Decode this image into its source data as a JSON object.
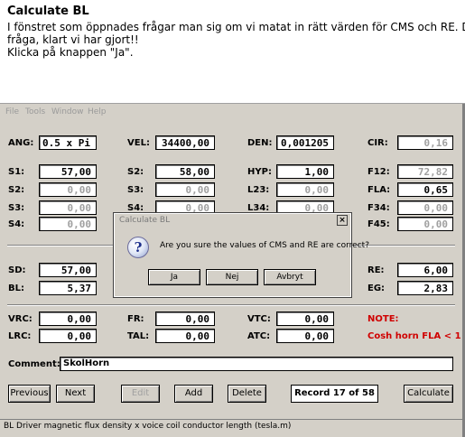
{
  "instructions": {
    "title": "Calculate BL",
    "lines": [
      "I fönstret som öppnades frågar man sig om vi matat in rätt värden för CMS och RE. Dum",
      "fråga, klart vi har gjort!!",
      "Klicka på knappen \"Ja\"."
    ]
  },
  "menu": [
    "File",
    "Tools",
    "Window",
    "Help"
  ],
  "fields": {
    "ang": {
      "label": "ANG:",
      "value": "0.5 x Pi"
    },
    "vel": {
      "label": "VEL:",
      "value": "34400,00"
    },
    "den": {
      "label": "DEN:",
      "value": "0,001205"
    },
    "cir": {
      "label": "CIR:",
      "value": "0,16"
    },
    "s1": {
      "label": "S1:",
      "value": "57,00"
    },
    "s2": {
      "label": "S2:",
      "value": "0,00"
    },
    "s3": {
      "label": "S3:",
      "value": "0,00"
    },
    "s4": {
      "label": "S4:",
      "value": "0,00"
    },
    "s2b": {
      "label": "S2:",
      "value": "58,00"
    },
    "s3b": {
      "label": "S3:",
      "value": "0,00"
    },
    "s4b": {
      "label": "S4:",
      "value": "0,00"
    },
    "hyp": {
      "label": "HYP:",
      "value": "1,00"
    },
    "l23": {
      "label": "L23:",
      "value": "0,00"
    },
    "l34": {
      "label": "L34:",
      "value": "0,00"
    },
    "f12": {
      "label": "F12:",
      "value": "72,82"
    },
    "fla": {
      "label": "FLA:",
      "value": "0,65"
    },
    "f34": {
      "label": "F34:",
      "value": "0,00"
    },
    "f45": {
      "label": "F45:",
      "value": "0,00"
    },
    "sd": {
      "label": "SD:",
      "value": "57,00"
    },
    "bl": {
      "label": "BL:",
      "value": "5,37"
    },
    "re": {
      "label": "RE:",
      "value": "6,00"
    },
    "eg": {
      "label": "EG:",
      "value": "2,83"
    },
    "vrc": {
      "label": "VRC:",
      "value": "0,00"
    },
    "lrc": {
      "label": "LRC:",
      "value": "0,00"
    },
    "fr": {
      "label": "FR:",
      "value": "0,00"
    },
    "tal": {
      "label": "TAL:",
      "value": "0,00"
    },
    "vtc": {
      "label": "VTC:",
      "value": "0,00"
    },
    "atc": {
      "label": "ATC:",
      "value": "0,00"
    }
  },
  "note": {
    "label": "NOTE:",
    "text": "Cosh horn  FLA < 1"
  },
  "comment": {
    "label": "Comment:",
    "value": "SkolHorn"
  },
  "buttons": {
    "previous": "Previous",
    "next": "Next",
    "edit": "Edit",
    "add": "Add",
    "delete": "Delete",
    "calculate": "Calculate"
  },
  "record": "Record 17 of 58",
  "status": "BL  Driver magnetic flux density x voice coil conductor length  (tesla.m)",
  "dialog": {
    "title": "Calculate BL",
    "close": "×",
    "icon": "?",
    "message": "Are you sure the values of CMS and RE are correct?",
    "yes": "Ja",
    "no": "Nej",
    "cancel": "Avbryt"
  },
  "colors": {
    "window_bg": "#d4d0c8",
    "note_red": "#d00000",
    "disabled_text": "#a0a0a0"
  }
}
